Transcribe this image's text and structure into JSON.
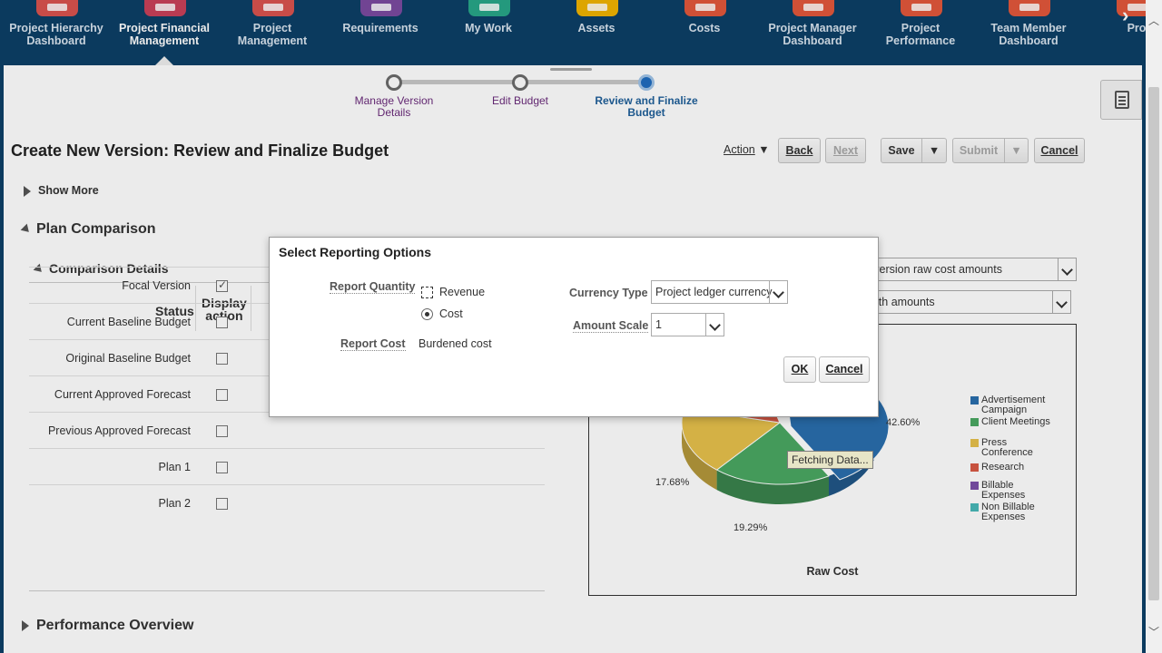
{
  "nav": {
    "items": [
      {
        "label": "Project Hierarchy\nDashboard",
        "color": "#d9534f"
      },
      {
        "label": "Project Financial\nManagement",
        "color": "#c9405a",
        "active": true
      },
      {
        "label": "Project\nManagement",
        "color": "#d9534f"
      },
      {
        "label": "Requirements",
        "color": "#7b4aa0"
      },
      {
        "label": "My Work",
        "color": "#28a788"
      },
      {
        "label": "Assets",
        "color": "#f0b400"
      },
      {
        "label": "Costs",
        "color": "#e2573b"
      },
      {
        "label": "Project Manager\nDashboard",
        "color": "#e2573b"
      },
      {
        "label": "Project\nPerformance",
        "color": "#e2573b"
      },
      {
        "label": "Team Member\nDashboard",
        "color": "#e2573b"
      },
      {
        "label": "Pro",
        "color": "#e2573b"
      }
    ],
    "next_icon": "chevron-right-icon"
  },
  "train": {
    "steps": [
      {
        "label": "Manage Version\nDetails",
        "current": false
      },
      {
        "label": "Edit Budget",
        "current": false
      },
      {
        "label": "Review and Finalize\nBudget",
        "current": true
      }
    ]
  },
  "page": {
    "title": "Create New Version: Review and Finalize Budget",
    "action_label": "Action",
    "back_label": "Back",
    "next_label": "Next",
    "save_label": "Save",
    "submit_label": "Submit",
    "cancel_label": "Cancel"
  },
  "sections": {
    "show_more": "Show More",
    "plan_comparison": "Plan Comparison",
    "comparison_details": "Comparison Details",
    "performance_overview": "Performance Overview"
  },
  "comparison_table": {
    "col_status": "Status",
    "col_display": "Display\naction",
    "rows": [
      {
        "name": "Focal Version",
        "checked": true
      },
      {
        "name": "Current Baseline Budget",
        "checked": false
      },
      {
        "name": "Original Baseline Budget",
        "checked": false
      },
      {
        "name": "Current Approved Forecast",
        "checked": false
      },
      {
        "name": "Previous Approved Forecast",
        "checked": false
      },
      {
        "name": "Plan 1",
        "checked": false
      },
      {
        "name": "Plan 2",
        "checked": false
      }
    ]
  },
  "chart_options": {
    "select1": "l version raw cost amounts",
    "select2": "with amounts"
  },
  "chart_data": {
    "type": "pie",
    "title": "Raw Cost",
    "labels": [
      "42.60%",
      "19.29%",
      "17.68%"
    ],
    "legend": [
      "Advertisement Campaign",
      "Client Meetings",
      "Press Conference",
      "Research",
      "Billable Expenses",
      "Non Billable Expenses"
    ],
    "colors": [
      "#2a6ead",
      "#4aa862",
      "#e7c14b",
      "#d85a45",
      "#7a4fa8",
      "#48b8b8"
    ],
    "fetching_text": "Fetching Data..."
  },
  "dialog": {
    "title": "Select Reporting Options",
    "report_quantity_label": "Report Quantity",
    "revenue_label": "Revenue",
    "cost_label": "Cost",
    "report_cost_label": "Report Cost",
    "report_cost_value": "Burdened cost",
    "currency_type_label": "Currency Type",
    "currency_type_value": "Project ledger currency",
    "amount_scale_label": "Amount Scale",
    "amount_scale_value": "1",
    "ok_label": "OK",
    "cancel_label": "Cancel"
  }
}
